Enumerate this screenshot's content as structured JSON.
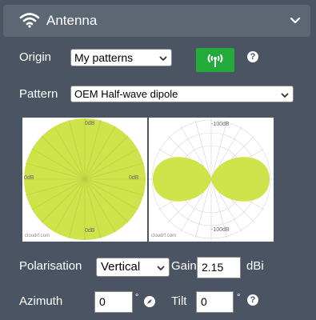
{
  "header": {
    "title": "Antenna",
    "icon": "wifi-icon",
    "chevron": "chevron-down-icon"
  },
  "origin": {
    "label": "Origin",
    "value": "My patterns",
    "button_icon": "antenna-icon"
  },
  "pattern": {
    "label": "Pattern",
    "value": "OEM Half-wave dipole"
  },
  "plots": {
    "left": {
      "top": "0dB",
      "left": "0dB",
      "right": "0dB",
      "bottom": "0dB",
      "watermark": "cloudrf.com"
    },
    "right": {
      "top": "-100dB",
      "bottom": "-100dB",
      "watermark": "cloudrf.com"
    }
  },
  "polarisation": {
    "label": "Polarisation",
    "value": "Vertical"
  },
  "gain": {
    "label": "Gain",
    "value": "2.15",
    "unit": "dBi"
  },
  "azimuth": {
    "label": "Azimuth",
    "value": "0",
    "unit": "°",
    "icon": "compass-icon"
  },
  "tilt": {
    "label": "Tilt",
    "value": "0",
    "unit": "°"
  },
  "help_glyph": "?",
  "colors": {
    "background": "#4a5462",
    "header": "#5d6774",
    "accent_green": "#22aa3a",
    "pattern_fill": "#cfe34a"
  }
}
